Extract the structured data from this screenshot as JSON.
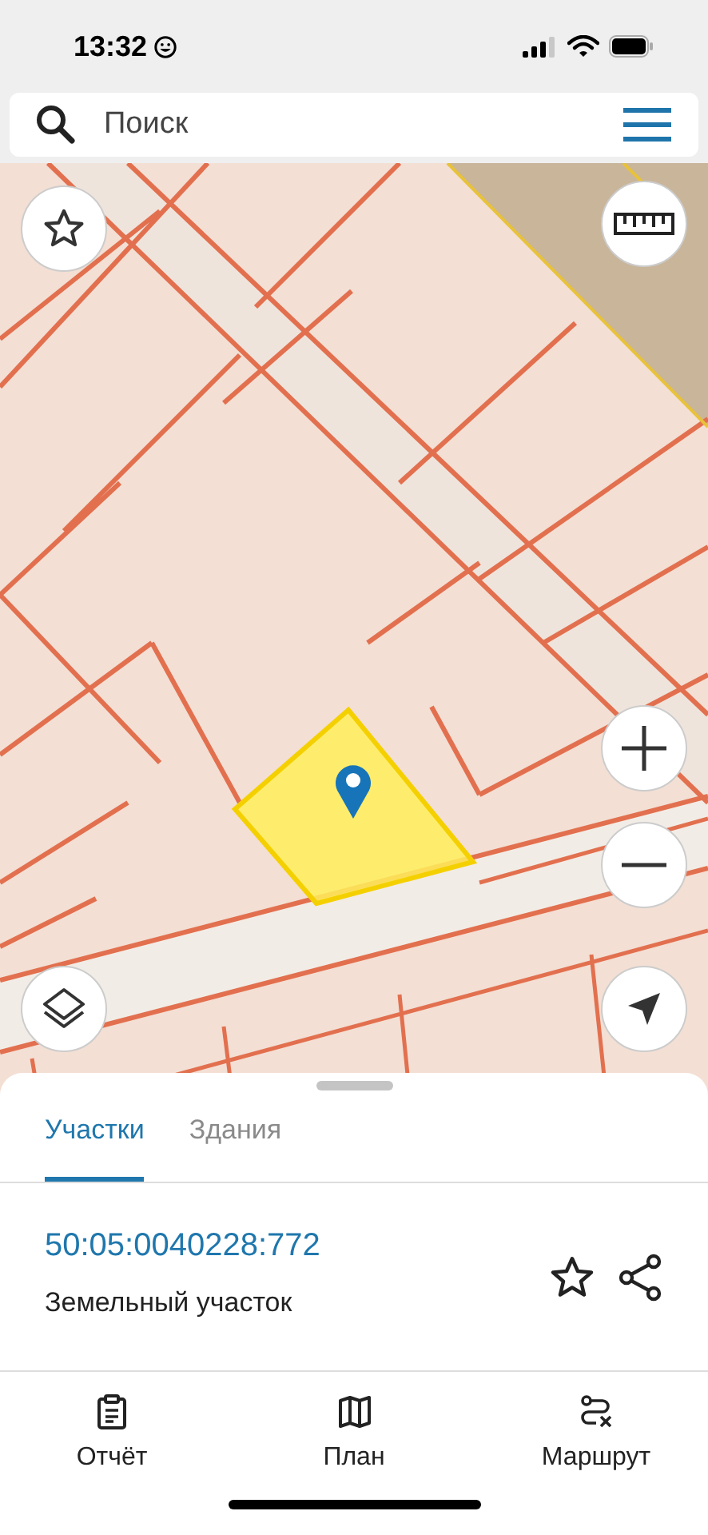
{
  "status_bar": {
    "time": "13:32"
  },
  "search": {
    "placeholder": "Поиск"
  },
  "tabs": [
    {
      "label": "Участки",
      "selected": true
    },
    {
      "label": "Здания",
      "selected": false
    }
  ],
  "parcel": {
    "number": "50:05:0040228:772",
    "type": "Земельный участок"
  },
  "nav": [
    {
      "label": "Отчёт",
      "kind": "report"
    },
    {
      "label": "План",
      "kind": "plan"
    },
    {
      "label": "Маршрут",
      "kind": "route"
    }
  ]
}
